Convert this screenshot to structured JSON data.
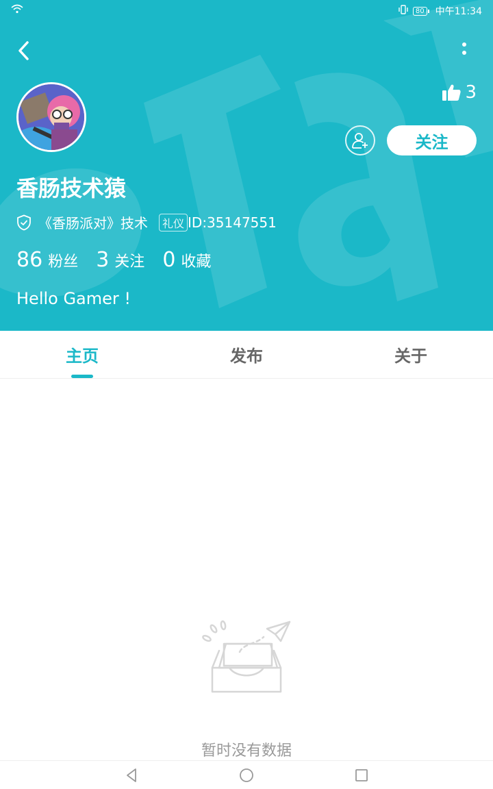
{
  "status_bar": {
    "time": "中午11:34",
    "battery": "80",
    "wifi_icon": "wifi-icon",
    "vibrate_icon": "vibrate-icon"
  },
  "header": {
    "background_color": "#1bb8c8",
    "back_icon": "chevron-left-icon",
    "more_icon": "more-vertical-icon",
    "likes_icon": "thumbs-up-icon",
    "likes_count": "3",
    "add_friend_icon": "add-user-icon",
    "follow_label": "关注"
  },
  "profile": {
    "username": "香肠技术猿",
    "verify_icon": "shield-check-icon",
    "verification": "《香肠派对》技术",
    "badge": "礼仪",
    "user_id": "ID:35147551",
    "stats": [
      {
        "value": "86",
        "label": "粉丝"
      },
      {
        "value": "3",
        "label": "关注"
      },
      {
        "value": "0",
        "label": "收藏"
      }
    ],
    "bio": "Hello Gamer !"
  },
  "tabs": [
    {
      "label": "主页",
      "active": true
    },
    {
      "label": "发布",
      "active": false
    },
    {
      "label": "关于",
      "active": false
    }
  ],
  "empty_state": {
    "icon": "empty-inbox-paper-plane-icon",
    "text": "暂时没有数据"
  },
  "nav_bar": {
    "back_icon": "triangle-back-icon",
    "home_icon": "circle-home-icon",
    "recents_icon": "square-recents-icon"
  }
}
